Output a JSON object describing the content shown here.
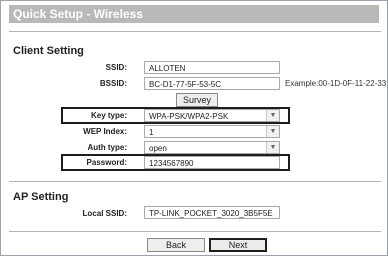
{
  "window": {
    "title": "Quick Setup - Wireless"
  },
  "client_setting": {
    "heading": "Client Setting",
    "ssid": {
      "label": "SSID:",
      "value": "ALLOTEN"
    },
    "bssid": {
      "label": "BSSID:",
      "value": "BC-D1-77-5F-53-5C",
      "example": "Example:00-1D-0F-11-22-33"
    },
    "survey_label": "Survey",
    "key_type": {
      "label": "Key type:",
      "value": "WPA-PSK/WPA2-PSK"
    },
    "wep_index": {
      "label": "WEP Index:",
      "value": "1"
    },
    "auth_type": {
      "label": "Auth type:",
      "value": "open"
    },
    "password": {
      "label": "Password:",
      "value": "1234567890"
    }
  },
  "ap_setting": {
    "heading": "AP Setting",
    "local_ssid": {
      "label": "Local SSID:",
      "value": "TP-LINK_POCKET_3020_3B5F5E"
    }
  },
  "footer": {
    "back_label": "Back",
    "next_label": "Next"
  },
  "icons": {
    "dropdown": "chevron-down-icon"
  },
  "colors": {
    "title_bar": "#b9b9b9",
    "highlight_border": "#1e1e1e"
  }
}
